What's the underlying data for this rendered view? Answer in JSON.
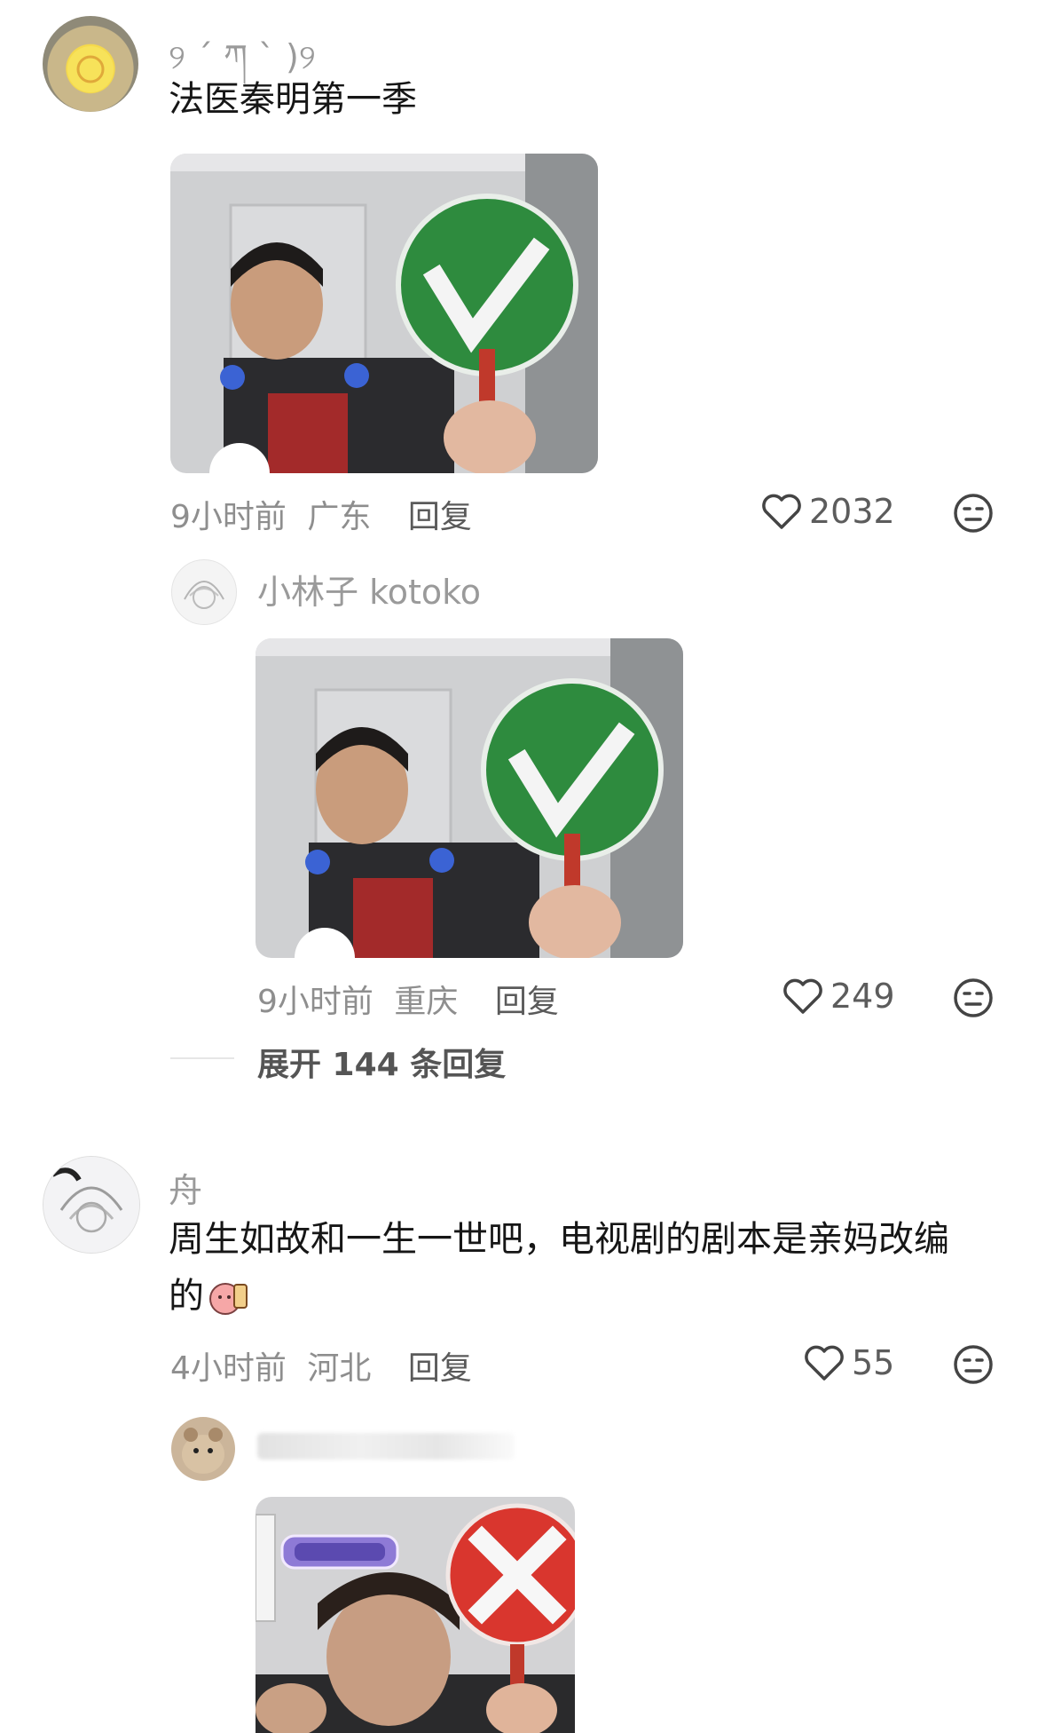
{
  "comments": [
    {
      "username": "୨ ´ ཀ ` )୨",
      "text": "法医秦明第一季",
      "time": "9小时前",
      "location": "广东",
      "reply_label": "回复",
      "likes": "2032",
      "sub_reply": {
        "username": "小林子 kotoko",
        "time": "9小时前",
        "location": "重庆",
        "reply_label": "回复",
        "likes": "249"
      },
      "expand_label": "展开 144 条回复"
    },
    {
      "username": "舟",
      "text_line1": "周生如故和一生一世吧，电视剧的剧本是亲妈改编",
      "text_line2": "的",
      "time": "4小时前",
      "location": "河北",
      "reply_label": "回复",
      "likes": "55",
      "sub_reply": {
        "username": ""
      }
    }
  ],
  "icons": {
    "like": "heart-outline-icon",
    "dislike": "meh-face-icon"
  },
  "colors": {
    "check_sign": "#2e8b3e",
    "cross_sign": "#d9362e"
  }
}
